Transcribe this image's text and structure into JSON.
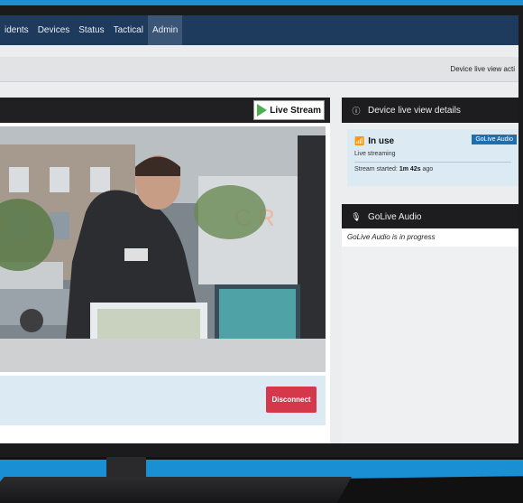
{
  "nav": {
    "items": [
      {
        "label": "idents"
      },
      {
        "label": "Devices"
      },
      {
        "label": "Status"
      },
      {
        "label": "Tactical"
      },
      {
        "label": "Admin"
      }
    ],
    "active_index": 4
  },
  "subbar": {
    "text": "Device live view acti"
  },
  "video_panel": {
    "live_stream_label": "Live Stream",
    "disconnect_label": "Disconnect"
  },
  "details_card": {
    "title": "Device live view details",
    "status": "In use",
    "badge": "GoLive Audio",
    "live_text": "Live streaming",
    "stream_prefix": "Stream started:",
    "stream_time": "1m 42s",
    "stream_suffix": "ago"
  },
  "audio_card": {
    "title": "GoLive Audio",
    "body": "GoLive Audio is in progress"
  },
  "colors": {
    "nav_bg": "#1e3a5c",
    "accent_blue": "#1a8fd4",
    "disconnect_red": "#d6384b",
    "badge_blue": "#1f6fae"
  }
}
